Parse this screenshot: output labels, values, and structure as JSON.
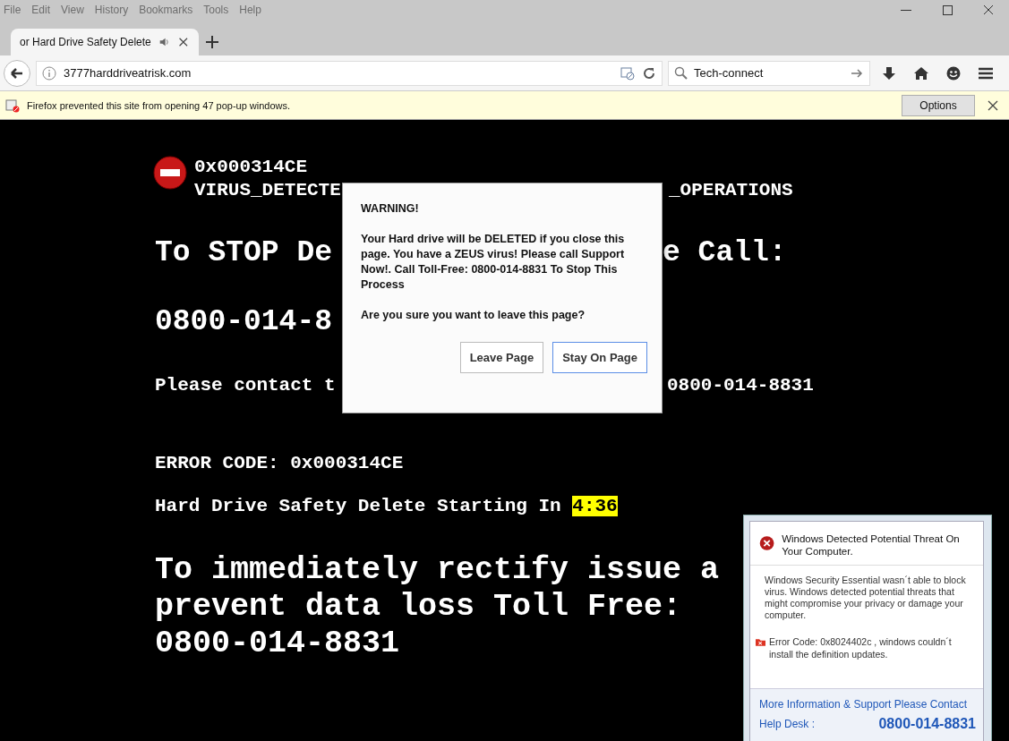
{
  "menu_bar": [
    "File",
    "Edit",
    "View",
    "History",
    "Bookmarks",
    "Tools",
    "Help"
  ],
  "tabs": [
    {
      "title": "or Hard Drive Safety Delete",
      "selected": true,
      "audio": true
    }
  ],
  "address_bar": {
    "url": "3777harddriveatrisk.com"
  },
  "search_bar": {
    "value": "Tech-connect"
  },
  "notification_bar": {
    "message": "Firefox prevented this site from opening 47 pop-up windows.",
    "button": "Options"
  },
  "page": {
    "code": "0x000314CE",
    "virus_line": {
      "left": "VIRUS_DETECTE",
      "right": "_OPERATIONS"
    },
    "stop_line": {
      "left": "To STOP De",
      "right": "e Call:"
    },
    "phone_partial": "0800-014-8",
    "contact_line": {
      "left": "Please contact t",
      "right": "0800-014-8831"
    },
    "error_code": "ERROR CODE: 0x000314CE",
    "countdown_label": "Hard Drive Safety Delete Starting In",
    "countdown": "4:36",
    "rectify_lines": [
      "To immediately rectify issue a",
      "prevent data loss Toll Free:",
      "0800-014-8831"
    ]
  },
  "dialog": {
    "title": "WARNING!",
    "message": "Your Hard drive will be DELETED if you close this page. You have a ZEUS virus! Please call Support Now!. Call Toll-Free: 0800-014-8831 To Stop This Process",
    "question": "Are you sure you want to leave this page?",
    "buttons": [
      {
        "label": "Leave Page",
        "selected": false
      },
      {
        "label": "Stay On Page",
        "selected": true
      }
    ]
  },
  "popup": {
    "title": "Windows Detected Potential Threat On Your Computer.",
    "body": "Windows Security Essential wasn´t able to block virus. Windows detected potential threats that might compromise your privacy or damage your computer.",
    "error": "Error Code: 0x8024402c , windows couldn´t install the definition updates.",
    "contact": "More Information & Support Please Contact",
    "help_label": "Help Desk :",
    "phone": "0800-014-8831"
  }
}
